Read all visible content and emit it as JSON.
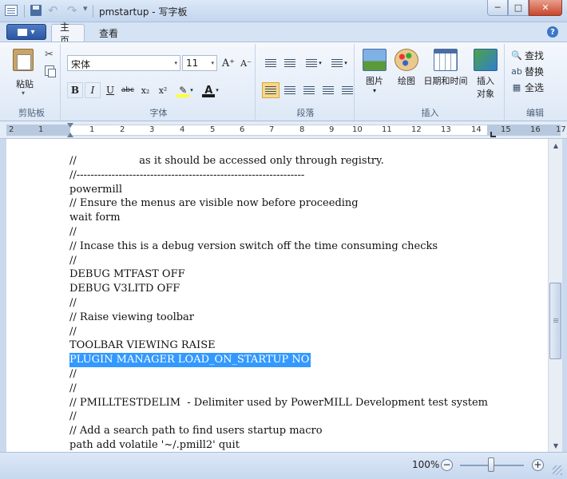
{
  "window": {
    "title": "pmstartup - 写字板",
    "minimize_glyph": "─",
    "maximize_glyph": "□",
    "close_glyph": "✕",
    "undo_glyph": "↶",
    "redo_glyph": "↷",
    "qa_more_glyph": "▾"
  },
  "tabs": {
    "home": "主页",
    "view": "查看",
    "help_glyph": "?"
  },
  "ribbon": {
    "clipboard": {
      "label": "剪贴板",
      "paste": "粘贴",
      "paste_arrow": "▾",
      "cut_glyph": "✂"
    },
    "font": {
      "label": "字体",
      "name": "宋体",
      "size": "11",
      "dd_arrow": "▾",
      "grow": "A⁺",
      "shrink": "A⁻",
      "bold": "B",
      "italic": "I",
      "underline": "U",
      "strike": "abc",
      "sub": "x₂",
      "sup": "x²",
      "highlight": "✎",
      "color": "A",
      "color_arrow": "▾"
    },
    "paragraph": {
      "label": "段落",
      "list_arrow": "▾",
      "spacing_arrow": "▾"
    },
    "insert": {
      "label": "插入",
      "picture": "图片",
      "picture_arrow": "▾",
      "paint": "绘图",
      "datetime": "日期和时间",
      "object_line1": "插入",
      "object_line2": "对象"
    },
    "editing": {
      "label": "编辑",
      "find": "查找",
      "replace": "替换",
      "select_all": "全选",
      "find_glyph": "🔍",
      "replace_glyph": "ab",
      "select_glyph": "▦"
    }
  },
  "ruler": {
    "numbers": [
      "2",
      "1",
      "1",
      "2",
      "3",
      "4",
      "5",
      "6",
      "7",
      "8",
      "9",
      "10",
      "11",
      "12",
      "13",
      "14",
      "15",
      "16",
      "17"
    ]
  },
  "document": {
    "lines": [
      "//                   as it should be accessed only through registry.",
      "//-----------------------------------------------------------------",
      "powermill",
      "// Ensure the menus are visible now before proceeding",
      "wait form",
      "//",
      "// Incase this is a debug version switch off the time consuming checks",
      "//",
      "DEBUG MTFAST OFF",
      "DEBUG V3LITD OFF",
      "//",
      "// Raise viewing toolbar",
      "//",
      "TOOLBAR VIEWING RAISE",
      "PLUGIN MANAGER LOAD_ON_STARTUP NO",
      "//",
      "//",
      "// PMILLTESTDELIM  - Delimiter used by PowerMILL Development test system",
      "//",
      "// Add a search path to find users startup macro",
      "path add volatile '~/.pmill2' quit"
    ],
    "selected_line_index": 14
  },
  "scrollbar": {
    "up_glyph": "▲",
    "down_glyph": "▼"
  },
  "status": {
    "zoom": "100%",
    "zoom_minus": "−",
    "zoom_plus": "+"
  },
  "colors": {
    "selection": "#3399ff",
    "ribbon_bg": "#dde8f6"
  }
}
